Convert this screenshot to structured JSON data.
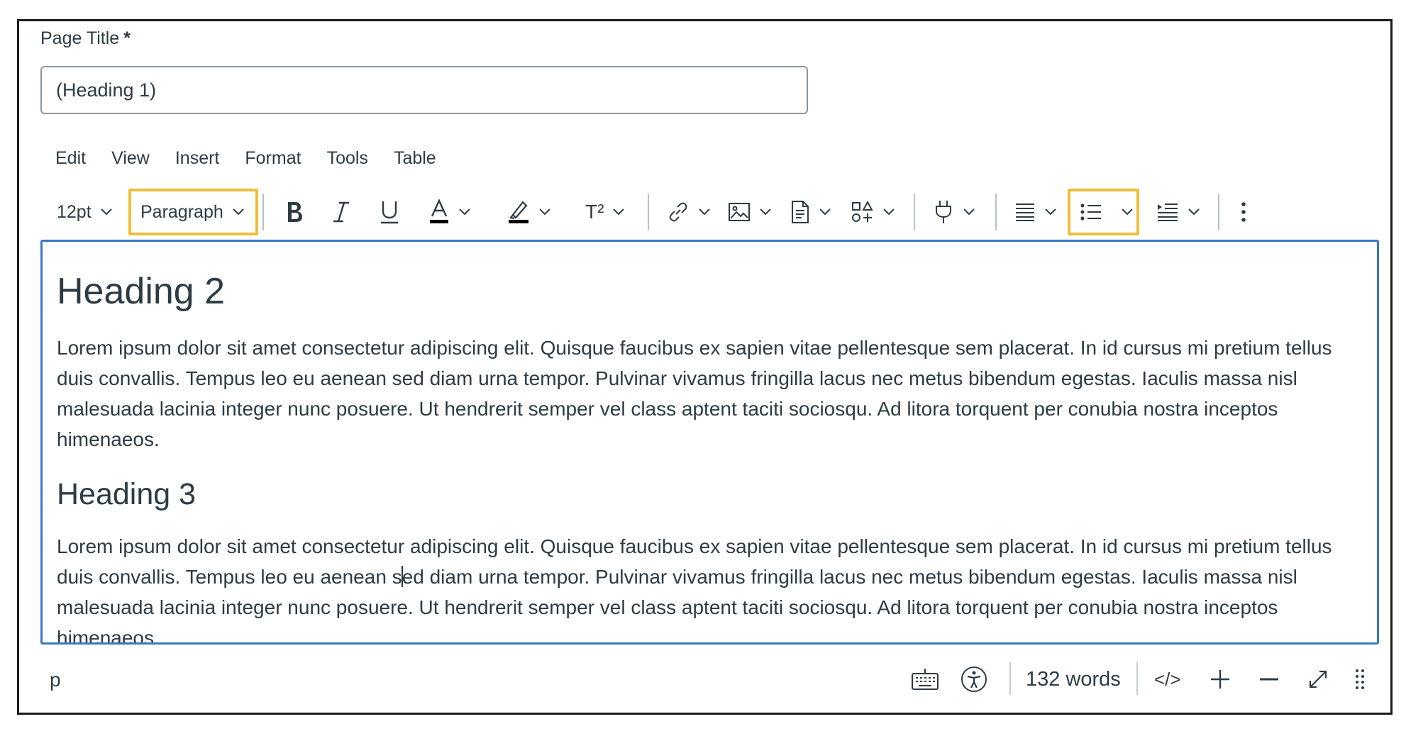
{
  "form": {
    "title_label": "Page Title",
    "required_mark": "*",
    "title_value": "(Heading 1)"
  },
  "menubar": {
    "edit": "Edit",
    "view": "View",
    "insert": "Insert",
    "format": "Format",
    "tools": "Tools",
    "table": "Table"
  },
  "toolbar": {
    "font_size": "12pt",
    "block_format": "Paragraph",
    "superscript": "T²",
    "highlight_color": "#f1bd39",
    "icons": [
      "bold-icon",
      "italic-icon",
      "underline-icon",
      "text-color-icon",
      "highlight-icon",
      "superscript-icon",
      "link-icon",
      "image-icon",
      "document-icon",
      "apps-icon",
      "plugin-icon",
      "align-icon",
      "bullet-list-icon",
      "indent-icon",
      "more-icon"
    ]
  },
  "content": {
    "heading2": "Heading 2",
    "paragraph1": "Lorem ipsum dolor sit amet consectetur adipiscing elit. Quisque faucibus ex sapien vitae pellentesque sem placerat. In id cursus mi pretium tellus duis convallis. Tempus leo eu aenean sed diam urna tempor. Pulvinar vivamus fringilla lacus nec metus bibendum egestas. Iaculis massa nisl malesuada lacinia integer nunc posuere. Ut hendrerit semper vel class aptent taciti sociosqu. Ad litora torquent per conubia nostra inceptos himenaeos.",
    "heading3": "Heading 3",
    "paragraph2_before_caret": "Lorem ipsum dolor sit amet consectetur adipiscing elit. Quisque faucibus ex sapien vitae pellentesque sem placerat. In id cursus mi pretium tellus duis convallis. Tempus leo eu aenean s",
    "paragraph2_after_caret": "ed diam urna tempor. Pulvinar vivamus fringilla lacus nec metus bibendum egestas. Iaculis massa nisl malesuada lacinia integer nunc posuere. Ut hendrerit semper vel class aptent taciti sociosqu. Ad litora torquent per conubia nostra inceptos himenaeos."
  },
  "statusbar": {
    "element_path": "p",
    "word_count": "132 words",
    "html_toggle": "</>"
  },
  "colors": {
    "text": "#2d3b45",
    "editor_border": "#3b78c0",
    "highlight": "#f1bd39"
  }
}
